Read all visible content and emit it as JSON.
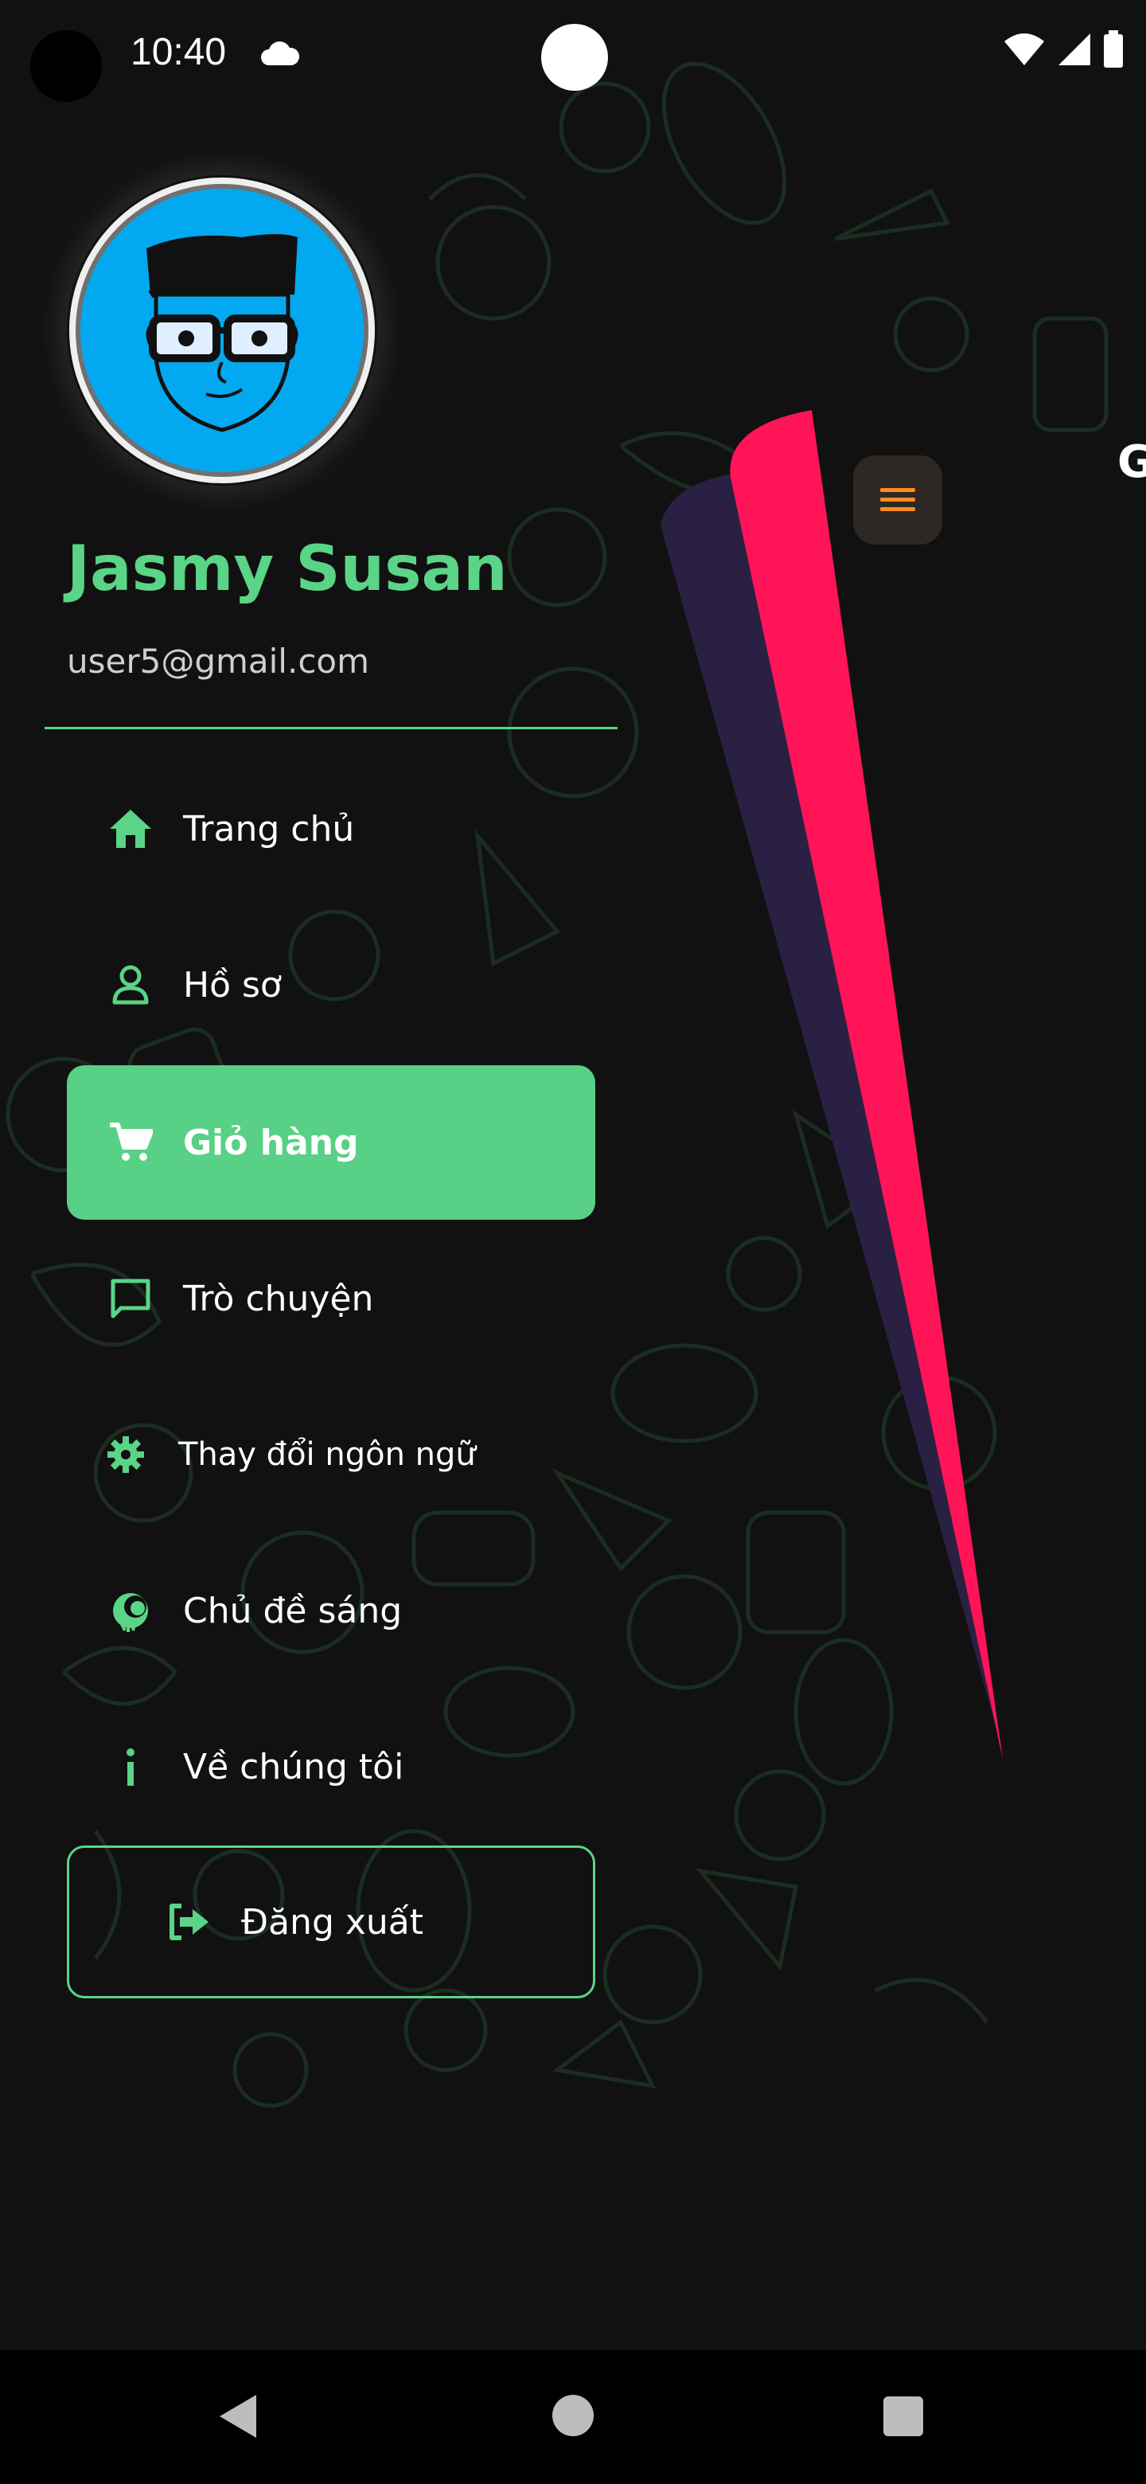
{
  "status_bar": {
    "time": "10:40",
    "cloud_icon": "cloud-icon",
    "wifi_icon": "wifi-icon",
    "signal_icon": "signal-icon",
    "battery_icon": "battery-icon"
  },
  "profile": {
    "name": "Jasmy Susan",
    "email": "user5@gmail.com",
    "avatar_icon": "cartoon-avatar"
  },
  "menu": {
    "items": [
      {
        "label": "Trang chủ",
        "icon": "home-icon",
        "active": false
      },
      {
        "label": "Hồ sơ",
        "icon": "user-icon",
        "active": false
      },
      {
        "label": "Giỏ hàng",
        "icon": "cart-icon",
        "active": true
      },
      {
        "label": "Trò chuyện",
        "icon": "chat-icon",
        "active": false
      },
      {
        "label": "Thay đổi ngôn ngữ",
        "icon": "gear-icon",
        "active": false
      },
      {
        "label": "Chủ đề sáng",
        "icon": "theme-icon",
        "active": false
      },
      {
        "label": "Về chúng tôi",
        "icon": "info-icon",
        "active": false
      }
    ],
    "logout_label": "Đăng xuất"
  },
  "edge_letter": "G",
  "colors": {
    "background": "#111111",
    "accent": "#5ad486",
    "ribbon_pink": "#ff1458",
    "ribbon_navy": "#2a2044",
    "hamburger_bg": "#2e2825",
    "hamburger_lines": "#ff8a1f"
  }
}
